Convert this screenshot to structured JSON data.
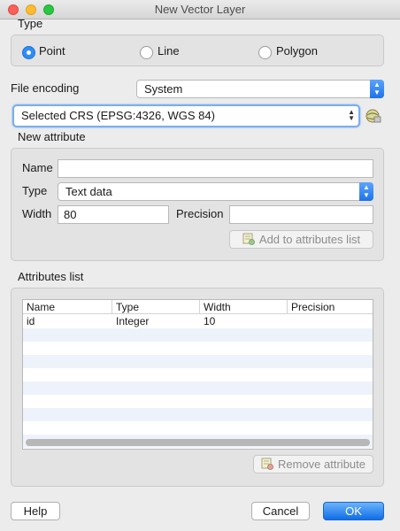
{
  "window": {
    "title": "New Vector Layer"
  },
  "type_group": {
    "label": "Type",
    "options": [
      {
        "label": "Point",
        "checked": true
      },
      {
        "label": "Line",
        "checked": false
      },
      {
        "label": "Polygon",
        "checked": false
      }
    ]
  },
  "file_encoding": {
    "label": "File encoding",
    "value": "System"
  },
  "crs": {
    "value": "Selected CRS (EPSG:4326, WGS 84)",
    "button_icon": "crs-selector-icon"
  },
  "new_attribute": {
    "label": "New attribute",
    "name_label": "Name",
    "name_value": "",
    "type_label": "Type",
    "type_value": "Text data",
    "width_label": "Width",
    "width_value": "80",
    "precision_label": "Precision",
    "precision_value": "",
    "add_button": "Add to attributes list"
  },
  "attributes_list": {
    "label": "Attributes list",
    "columns": [
      "Name",
      "Type",
      "Width",
      "Precision"
    ],
    "rows": [
      {
        "name": "id",
        "type": "Integer",
        "width": "10",
        "precision": ""
      }
    ],
    "remove_button": "Remove attribute"
  },
  "footer": {
    "help": "Help",
    "cancel": "Cancel",
    "ok": "OK"
  },
  "colors": {
    "accent": "#2f8cf7",
    "row_alt": "#eef3fb"
  }
}
